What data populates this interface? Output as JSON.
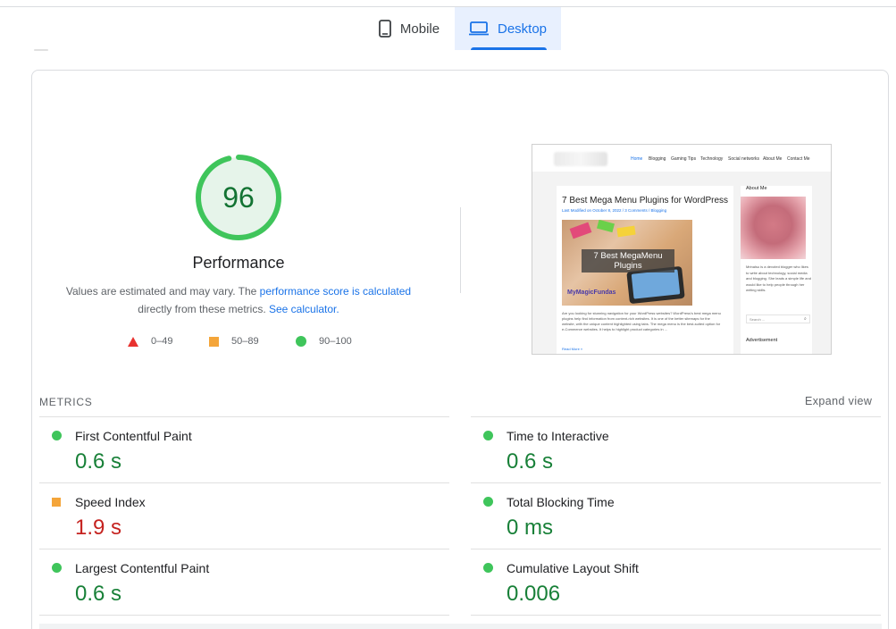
{
  "tabs": [
    {
      "label": "Mobile",
      "icon": "smartphone-icon",
      "active": false
    },
    {
      "label": "Desktop",
      "icon": "laptop-icon",
      "active": true
    }
  ],
  "colors": {
    "accent": "#1a73e8",
    "pass": "#0cce6b",
    "average": "#ffa400",
    "fail": "#ff4e42",
    "pass_text": "#188038",
    "fail_text": "#c5221f"
  },
  "score": {
    "value": "96",
    "fraction": 0.96,
    "title": "Performance",
    "description_prefix": "Values are estimated and may vary. The ",
    "description_link": "performance score is calculated",
    "description_mid": "directly from these metrics.",
    "calculator_link": "See calculator."
  },
  "legend": [
    {
      "range": "0–49",
      "icon": "triangle-icon"
    },
    {
      "range": "50–89",
      "icon": "square-icon"
    },
    {
      "range": "90–100",
      "icon": "circle-icon"
    }
  ],
  "screenshot": {
    "menu": [
      "Home",
      "Blogging",
      "Gaming Tips",
      "Technology",
      "Social networks",
      "About Me",
      "Contact Me"
    ],
    "post_title": "7 Best Mega Menu Plugins for WordPress",
    "post_meta": "Last Modified on October 8, 2022 / 3 Comments / Blogging",
    "image_banner": "7 Best MegaMenu Plugins",
    "image_brand": "MyMagicFundas",
    "excerpt": "Are you looking for stunning navigation for your WordPress websites? WordPress's best mega menu plugins help find information from content-rich websites. It is one of the better sitemaps for the website, with the unique content highlighted using tabs. The mega menu is the best-suited option for e-Commerce websites. It helps to highlight product categories in ...",
    "read_more": "Read More »",
    "sidebar_about": "About Me",
    "sidebar_bio": "Mrinalsu is a devoted blogger who likes to write about technology, social media and blogging. She leads a simple life and would like to help people through her writing skills.",
    "search_placeholder": "Search ...",
    "advertisement": "Advertisement"
  },
  "metrics": {
    "label": "METRICS",
    "expand": "Expand view",
    "items": [
      {
        "name": "First Contentful Paint",
        "value": "0.6 s",
        "status": "pass"
      },
      {
        "name": "Time to Interactive",
        "value": "0.6 s",
        "status": "pass"
      },
      {
        "name": "Speed Index",
        "value": "1.9 s",
        "status": "average"
      },
      {
        "name": "Total Blocking Time",
        "value": "0 ms",
        "status": "pass"
      },
      {
        "name": "Largest Contentful Paint",
        "value": "0.6 s",
        "status": "pass"
      },
      {
        "name": "Cumulative Layout Shift",
        "value": "0.006",
        "status": "pass"
      }
    ]
  }
}
